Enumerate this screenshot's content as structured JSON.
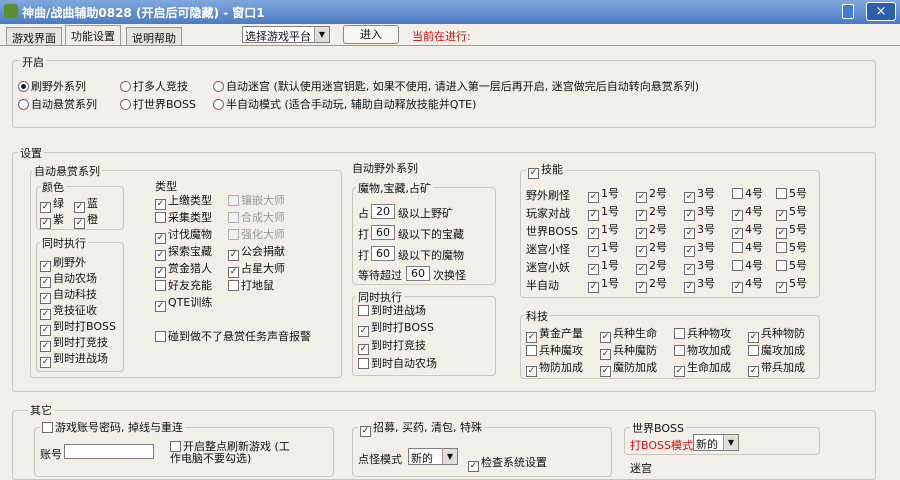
{
  "window": {
    "title": "神曲/战曲辅助0828 (开启后可隐藏) - 窗口1",
    "close_icon": "×"
  },
  "tabs": [
    "游戏界面",
    "功能设置",
    "说明帮助"
  ],
  "toolbar": {
    "platform_select": "选择游戏平台",
    "enter_button": "进入",
    "status": "当前在进行:"
  },
  "start": {
    "title": "开启",
    "options": [
      {
        "label": "刷野外系列",
        "checked": true
      },
      {
        "label": "打多人竞技",
        "checked": false
      },
      {
        "label": "自动迷宫 (默认使用迷宫钥匙, 如果不使用, 请进入第一层后再开启, 迷宫做完后自动转向悬赏系列)",
        "checked": false
      },
      {
        "label": "自动悬赏系列",
        "checked": false
      },
      {
        "label": "打世界BOSS",
        "checked": false
      },
      {
        "label": "半自动模式 (适合手动玩, 辅助自动释放技能并QTE)",
        "checked": false
      }
    ]
  },
  "settings": {
    "title": "设置",
    "bounty": {
      "title": "自动悬赏系列",
      "colors": {
        "title": "颜色",
        "items": [
          {
            "label": "绿",
            "checked": true
          },
          {
            "label": "蓝",
            "checked": true
          },
          {
            "label": "紫",
            "checked": true
          },
          {
            "label": "橙",
            "checked": true
          }
        ]
      },
      "types": {
        "title": "类型",
        "items": [
          {
            "label": "上缴类型",
            "checked": true,
            "disabled": false
          },
          {
            "label": "镶嵌大师",
            "checked": false,
            "disabled": true
          },
          {
            "label": "采集类型",
            "checked": false,
            "disabled": false
          },
          {
            "label": "合成大师",
            "checked": false,
            "disabled": true
          },
          {
            "label": "讨伐魔物",
            "checked": true,
            "disabled": false
          },
          {
            "label": "强化大师",
            "checked": false,
            "disabled": true
          },
          {
            "label": "探索宝藏",
            "checked": true,
            "disabled": false
          },
          {
            "label": "公会捐献",
            "checked": true,
            "disabled": false
          },
          {
            "label": "赏金猎人",
            "checked": true,
            "disabled": false
          },
          {
            "label": "占星大师",
            "checked": true,
            "disabled": false
          },
          {
            "label": "好友充能",
            "checked": false,
            "disabled": false
          },
          {
            "label": "打地鼠",
            "checked": false,
            "disabled": false
          },
          {
            "label": "QTE训练",
            "checked": true,
            "disabled": false
          }
        ]
      },
      "concurrent": {
        "title": "同时执行",
        "items": [
          {
            "label": "刷野外",
            "checked": true
          },
          {
            "label": "自动农场",
            "checked": true
          },
          {
            "label": "自动科技",
            "checked": true
          },
          {
            "label": "竞技征收",
            "checked": true
          },
          {
            "label": "到时打BOSS",
            "checked": true
          },
          {
            "label": "到时打竞技",
            "checked": true
          },
          {
            "label": "到时进战场",
            "checked": true
          }
        ]
      },
      "alert": {
        "label": "碰到做不了悬赏任务声音报警",
        "checked": false
      }
    },
    "wild": {
      "title": "自动野外系列",
      "sub_title": "魔物,宝藏,占矿",
      "rows": [
        {
          "pre": "占",
          "value": "20",
          "post": "级以上野矿"
        },
        {
          "pre": "打",
          "value": "60",
          "post": "级以下的宝藏"
        },
        {
          "pre": "打",
          "value": "60",
          "post": "级以下的魔物"
        },
        {
          "pre": "等待超过",
          "value": "60",
          "post": "次换怪"
        }
      ],
      "concurrent": {
        "title": "同时执行",
        "items": [
          {
            "label": "到时进战场",
            "checked": false
          },
          {
            "label": "到时打BOSS",
            "checked": true
          },
          {
            "label": "到时打竞技",
            "checked": true
          },
          {
            "label": "到时自动农场",
            "checked": false
          }
        ]
      }
    },
    "skills": {
      "label": "技能",
      "checked": true,
      "rows": [
        {
          "name": "野外刷怪",
          "slots": [
            {
              "label": "1号",
              "checked": true
            },
            {
              "label": "2号",
              "checked": true
            },
            {
              "label": "3号",
              "checked": true
            },
            {
              "label": "4号",
              "checked": false
            },
            {
              "label": "5号",
              "checked": false
            }
          ]
        },
        {
          "name": "玩家对战",
          "slots": [
            {
              "label": "1号",
              "checked": true
            },
            {
              "label": "2号",
              "checked": true
            },
            {
              "label": "3号",
              "checked": true
            },
            {
              "label": "4号",
              "checked": true
            },
            {
              "label": "5号",
              "checked": true
            }
          ]
        },
        {
          "name": "世界BOSS",
          "slots": [
            {
              "label": "1号",
              "checked": true
            },
            {
              "label": "2号",
              "checked": true
            },
            {
              "label": "3号",
              "checked": true
            },
            {
              "label": "4号",
              "checked": true
            },
            {
              "label": "5号",
              "checked": true
            }
          ]
        },
        {
          "name": "迷宫小怪",
          "slots": [
            {
              "label": "1号",
              "checked": true
            },
            {
              "label": "2号",
              "checked": true
            },
            {
              "label": "3号",
              "checked": true
            },
            {
              "label": "4号",
              "checked": false
            },
            {
              "label": "5号",
              "checked": false
            }
          ]
        },
        {
          "name": "迷宫小妖",
          "slots": [
            {
              "label": "1号",
              "checked": true
            },
            {
              "label": "2号",
              "checked": true
            },
            {
              "label": "3号",
              "checked": true
            },
            {
              "label": "4号",
              "checked": false
            },
            {
              "label": "5号",
              "checked": false
            }
          ]
        },
        {
          "name": "半自动",
          "slots": [
            {
              "label": "1号",
              "checked": true
            },
            {
              "label": "2号",
              "checked": true
            },
            {
              "label": "3号",
              "checked": true
            },
            {
              "label": "4号",
              "checked": true
            },
            {
              "label": "5号",
              "checked": true
            }
          ]
        }
      ]
    },
    "tech": {
      "title": "科技",
      "items": [
        {
          "label": "黄金产量",
          "checked": true
        },
        {
          "label": "兵种生命",
          "checked": true
        },
        {
          "label": "兵种物攻",
          "checked": false
        },
        {
          "label": "兵种物防",
          "checked": true
        },
        {
          "label": "兵种魔攻",
          "checked": false
        },
        {
          "label": "兵种魔防",
          "checked": true
        },
        {
          "label": "物攻加成",
          "checked": false
        },
        {
          "label": "魔攻加成",
          "checked": false
        },
        {
          "label": "物防加成",
          "checked": true
        },
        {
          "label": "魔防加成",
          "checked": true
        },
        {
          "label": "生命加成",
          "checked": true
        },
        {
          "label": "带兵加成",
          "checked": true
        }
      ]
    }
  },
  "other": {
    "title": "其它",
    "reconnect": {
      "label": "游戏账号密码, 掉线与重连",
      "checked": false
    },
    "account_label": "账号",
    "refresh": {
      "label": "开启整点刷新游戏 (工作电脑不要勾选)",
      "checked": false
    },
    "recruit": {
      "label": "招募, 买药, 清包, 特殊",
      "checked": true
    },
    "point_mode": "点怪模式",
    "point_value": "新的",
    "check_system": {
      "label": "检查系统设置",
      "checked": true
    },
    "world_boss": {
      "title": "世界BOSS",
      "mode_label": "打BOSS模式",
      "mode_value": "新的"
    },
    "maze_title": "迷宫"
  }
}
